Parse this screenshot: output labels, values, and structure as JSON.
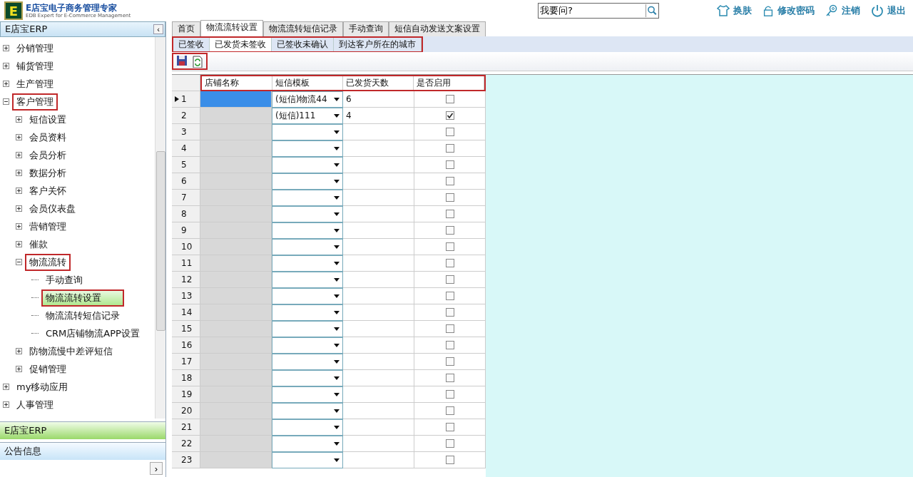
{
  "logo": {
    "title": "E店宝电子商务管理专家",
    "subtitle": "EDB Expert for E-Commerce Management",
    "mark": "E"
  },
  "search": {
    "value": "我要问?"
  },
  "header_actions": [
    {
      "kind": "skin",
      "label": "换肤"
    },
    {
      "kind": "lock",
      "label": "修改密码"
    },
    {
      "kind": "key",
      "label": "注销"
    },
    {
      "kind": "power",
      "label": "退出"
    }
  ],
  "sidebar": {
    "title": "E店宝ERP",
    "collapse": "‹",
    "items": [
      {
        "label": "分销管理",
        "expanded": false,
        "selected": false,
        "marked": false
      },
      {
        "label": "铺货管理",
        "expanded": false,
        "selected": false,
        "marked": false
      },
      {
        "label": "生产管理",
        "expanded": false,
        "selected": false,
        "marked": false
      },
      {
        "label": "客户管理",
        "expanded": true,
        "selected": false,
        "marked": true,
        "children": [
          {
            "label": "短信设置",
            "expanded": false,
            "selected": false,
            "marked": false
          },
          {
            "label": "会员资料",
            "expanded": false,
            "selected": false,
            "marked": false
          },
          {
            "label": "会员分析",
            "expanded": false,
            "selected": false,
            "marked": false
          },
          {
            "label": "数据分析",
            "expanded": false,
            "selected": false,
            "marked": false
          },
          {
            "label": "客户关怀",
            "expanded": false,
            "selected": false,
            "marked": false
          },
          {
            "label": "会员仪表盘",
            "expanded": false,
            "selected": false,
            "marked": false
          },
          {
            "label": "营销管理",
            "expanded": false,
            "selected": false,
            "marked": false
          },
          {
            "label": "催款",
            "expanded": false,
            "selected": false,
            "marked": false
          },
          {
            "label": "物流流转",
            "expanded": true,
            "selected": false,
            "marked": true,
            "children": [
              {
                "label": "手动查询",
                "selected": false,
                "marked": false
              },
              {
                "label": "物流流转设置",
                "selected": true,
                "marked": true
              },
              {
                "label": "物流流转短信记录",
                "selected": false,
                "marked": false
              },
              {
                "label": "CRM店铺物流APP设置",
                "selected": false,
                "marked": false
              }
            ]
          },
          {
            "label": "防物流慢中差评短信",
            "expanded": false,
            "selected": false,
            "marked": false
          },
          {
            "label": "促销管理",
            "expanded": false,
            "selected": false,
            "marked": false
          }
        ]
      },
      {
        "label": "my移动应用",
        "expanded": false,
        "selected": false,
        "marked": false
      },
      {
        "label": "人事管理",
        "expanded": false,
        "selected": false,
        "marked": false
      }
    ],
    "accordion": [
      {
        "label": "E店宝ERP",
        "selected": true
      },
      {
        "label": "公告信息",
        "selected": false
      }
    ],
    "expand_button": "›"
  },
  "tabs": [
    {
      "label": "首页",
      "selected": false
    },
    {
      "label": "物流流转设置",
      "selected": true
    },
    {
      "label": "物流流转短信记录",
      "selected": false
    },
    {
      "label": "手动查询",
      "selected": false
    },
    {
      "label": "短信自动发送文案设置",
      "selected": false
    }
  ],
  "subtabs": {
    "marked": true,
    "items": [
      {
        "label": "已签收",
        "selected": false
      },
      {
        "label": "已发货未签收",
        "selected": true
      },
      {
        "label": "已签收未确认",
        "selected": false
      },
      {
        "label": "到达客户所在的城市",
        "selected": false
      }
    ]
  },
  "toolbar": {
    "marked": true
  },
  "table": {
    "header_marked": true,
    "columns": [
      "店铺名称",
      "短信模板",
      "已发货天数",
      "是否启用"
    ],
    "rows": [
      {
        "num": "1",
        "selected": true,
        "template": "(短信)物流44",
        "days": "6",
        "enabled": false
      },
      {
        "num": "2",
        "selected": false,
        "template": "(短信)111",
        "days": "4",
        "enabled": true
      },
      {
        "num": "3",
        "selected": false,
        "enabled": false
      },
      {
        "num": "4",
        "selected": false,
        "enabled": false
      },
      {
        "num": "5",
        "selected": false,
        "enabled": false
      },
      {
        "num": "6",
        "selected": false,
        "enabled": false
      },
      {
        "num": "7",
        "selected": false,
        "enabled": false
      },
      {
        "num": "8",
        "selected": false,
        "enabled": false
      },
      {
        "num": "9",
        "selected": false,
        "enabled": false
      },
      {
        "num": "10",
        "selected": false,
        "enabled": false
      },
      {
        "num": "11",
        "selected": false,
        "enabled": false
      },
      {
        "num": "12",
        "selected": false,
        "enabled": false
      },
      {
        "num": "13",
        "selected": false,
        "enabled": false
      },
      {
        "num": "14",
        "selected": false,
        "enabled": false
      },
      {
        "num": "15",
        "selected": false,
        "enabled": false
      },
      {
        "num": "16",
        "selected": false,
        "enabled": false
      },
      {
        "num": "17",
        "selected": false,
        "enabled": false
      },
      {
        "num": "18",
        "selected": false,
        "enabled": false
      },
      {
        "num": "19",
        "selected": false,
        "enabled": false
      },
      {
        "num": "20",
        "selected": false,
        "enabled": false
      },
      {
        "num": "21",
        "selected": false,
        "enabled": false
      },
      {
        "num": "22",
        "selected": false,
        "enabled": false
      },
      {
        "num": "23",
        "selected": false,
        "enabled": false
      }
    ]
  }
}
